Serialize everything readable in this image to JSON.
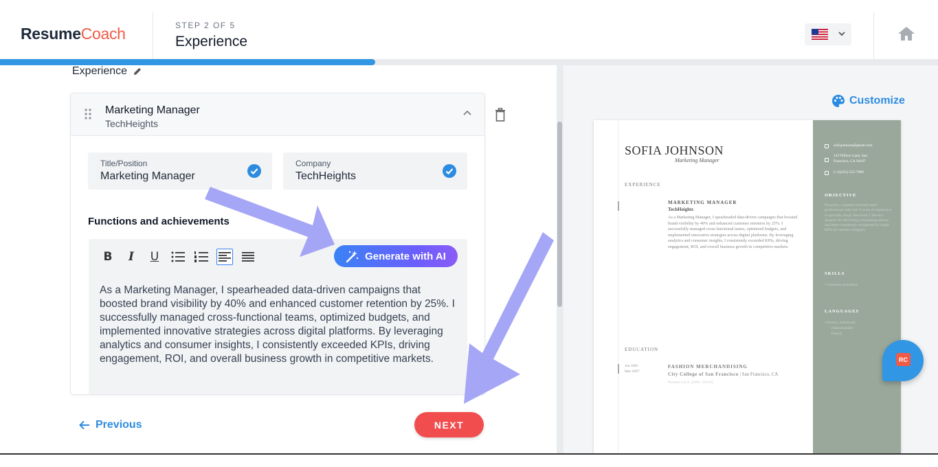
{
  "header": {
    "logo_part1": "Resume",
    "logo_part2": "Coach",
    "step_label": "STEP 2 OF 5",
    "step_title": "Experience",
    "language_flag": "us-flag-icon"
  },
  "progress": {
    "fraction": 0.4
  },
  "left": {
    "section_heading": "Experience",
    "entry": {
      "title": "Marketing Manager",
      "company": "TechHeights",
      "fields": [
        {
          "label": "Title/Position",
          "value": "Marketing Manager"
        },
        {
          "label": "Company",
          "value": "TechHeights"
        }
      ],
      "functions_label": "Functions and achievements",
      "ai_button": "Generate with AI",
      "description": "As a Marketing Manager, I spearheaded data-driven campaigns that boosted brand visibility by 40% and enhanced customer retention by 25%. I successfully managed cross-functional teams, optimized budgets, and implemented innovative strategies across digital platforms. By leveraging analytics and consumer insights, I consistently exceeded KPIs, driving engagement, ROI, and overall business growth in competitive markets."
    },
    "nav": {
      "previous": "Previous",
      "next": "NEXT"
    }
  },
  "right": {
    "customize": "Customize",
    "resume": {
      "name": "SOFIA JOHNSON",
      "role": "Marketing Manager",
      "experience_heading": "EXPERIENCE",
      "job_title": "MARKETING MANAGER",
      "job_company": "TechHeights",
      "job_description": "As a Marketing Manager, I spearheaded data-driven campaigns that boosted brand visibility by 40% and enhanced customer retention by 25%. I successfully managed cross-functional teams, optimized budgets, and implemented innovative strategies across digital platforms. By leveraging analytics and consumer insights, I consistently exceeded KPIs, driving engagement, ROI, and overall business growth in competitive markets.",
      "education_heading": "EDUCATION",
      "edu_date_start": "Jun 2005",
      "edu_date_end": "Mar 2007",
      "edu_degree": "FASHION MERCHANDISING",
      "edu_school": "City College of San Francisco",
      "edu_location": "San Francisco, CA",
      "edu_note": "Pursued a B.S. (GPA: 3.8/4.0)",
      "email": "sofiajohnson@gmail.com",
      "address_line1": "123 Willow Lane, San",
      "address_line2": "Francisco, CA 94107",
      "phone": "(+1)(415) 555-7890",
      "objective_heading": "OBJECTIVE",
      "objective_text": "Proactive, customer-oriented retail professional with over 6 years of experience in specialty shops. Received 3 'Service Awards' for delivering outstanding service and been consistently recognized by major KPIs for mystery shoppers.",
      "skills_heading": "SKILLS",
      "skills_item": "• Customer assistance",
      "languages_heading": "LANGUAGES",
      "languages_item": "• French  |  Advanced",
      "languages_sub": "(Intermediate)",
      "languages_sub2": "French"
    },
    "badge": "RC"
  },
  "colors": {
    "brand_blue": "#3196e3",
    "brand_red": "#f14d4f",
    "logo_dark": "#1e2a3b",
    "logo_accent": "#f15a46",
    "sidebar_green": "#9aa89b",
    "annotation_arrow": "#9b9cf5"
  }
}
